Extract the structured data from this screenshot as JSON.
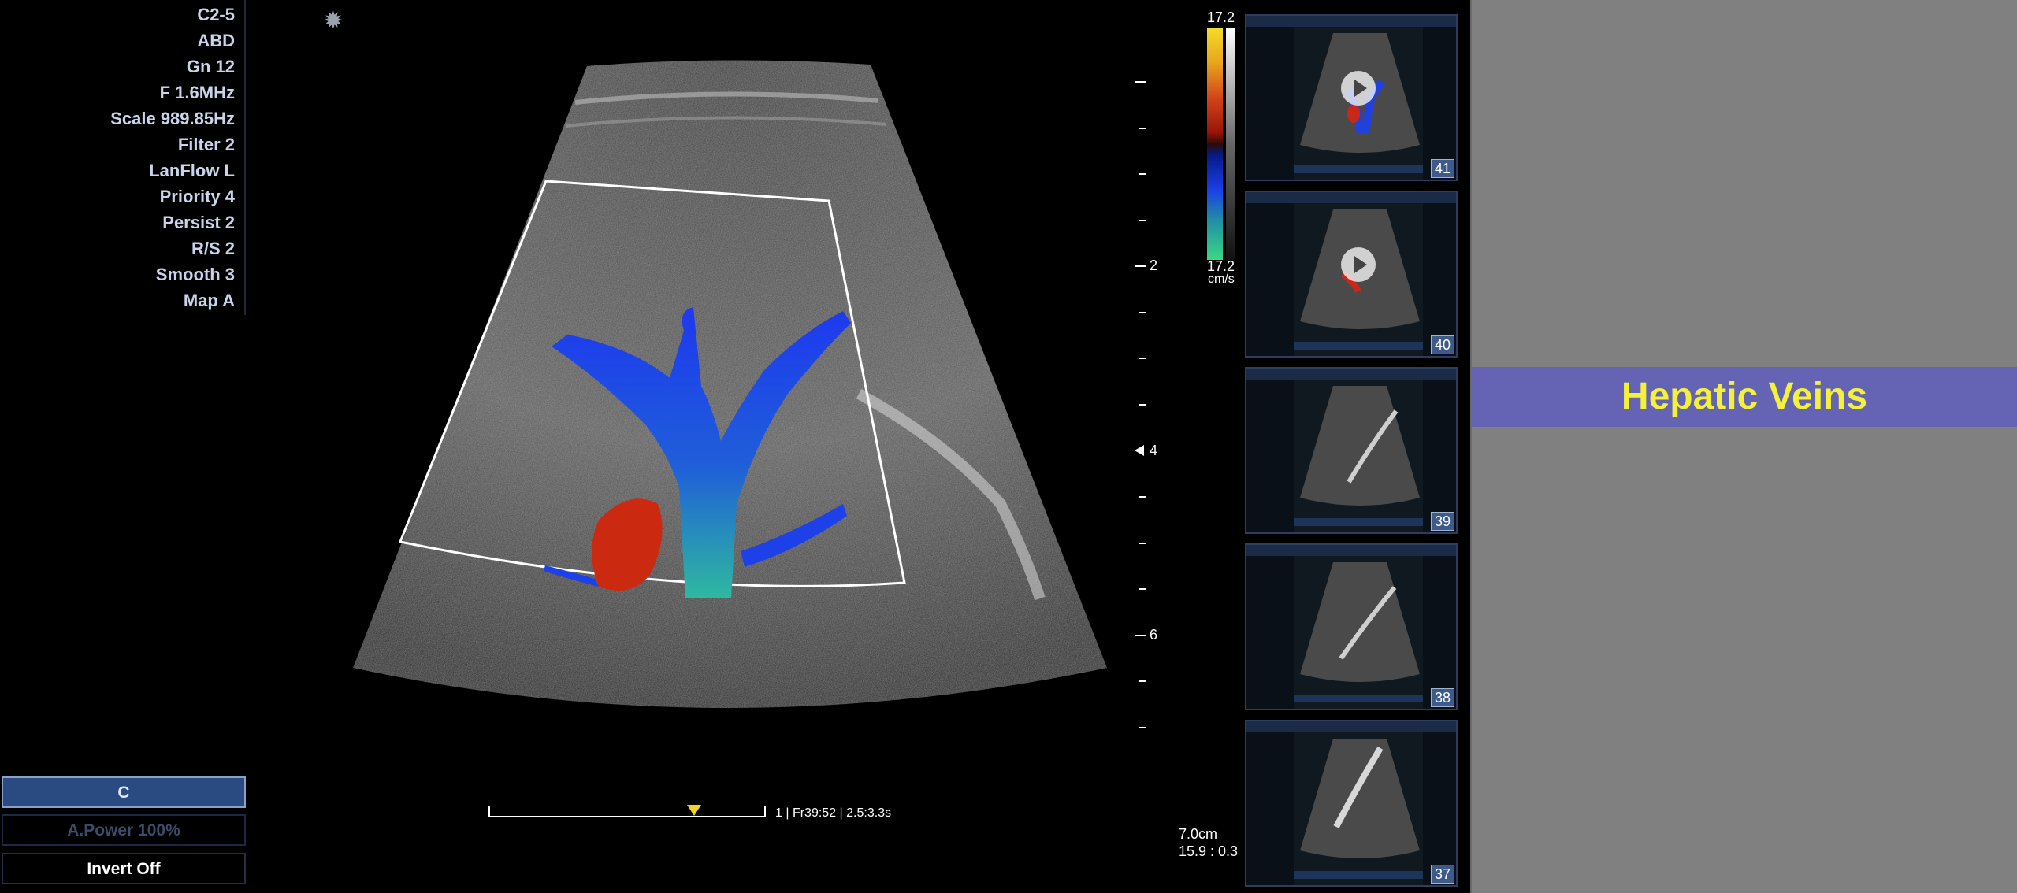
{
  "params": [
    "C2-5",
    "ABD",
    "Gn 12",
    "F 1.6MHz",
    "Scale 989.85Hz",
    "Filter 2",
    "LanFlow L",
    "Priority 4",
    "Persist 2",
    "R/S 2",
    "Smooth 3",
    "Map A"
  ],
  "gear_icon": "gear-icon",
  "depth_scale": {
    "labels": [
      "2",
      "4",
      "6"
    ]
  },
  "colorbar": {
    "max": "17.2",
    "min": "17.2",
    "unit": "cm/s"
  },
  "cine": {
    "info": "1 | Fr39:52 | 2.5:3.3s"
  },
  "measurements": {
    "depth": "7.0cm",
    "fr": "15.9 : 0.3"
  },
  "modes": {
    "c": "C",
    "apower": "A.Power 100%",
    "invert": "Invert  Off"
  },
  "thumbnails": [
    {
      "number": "41",
      "has_play": true,
      "doppler": true
    },
    {
      "number": "40",
      "has_play": true,
      "doppler": true
    },
    {
      "number": "39",
      "has_play": false,
      "doppler": false
    },
    {
      "number": "38",
      "has_play": false,
      "doppler": false
    },
    {
      "number": "37",
      "has_play": false,
      "doppler": false
    }
  ],
  "banner": {
    "title": "Hepatic Veins"
  },
  "colors": {
    "banner_bg": "#6563b4",
    "banner_text": "#f4f13a",
    "panel_bg": "#808080",
    "selected_mode": "#2a4a82"
  }
}
